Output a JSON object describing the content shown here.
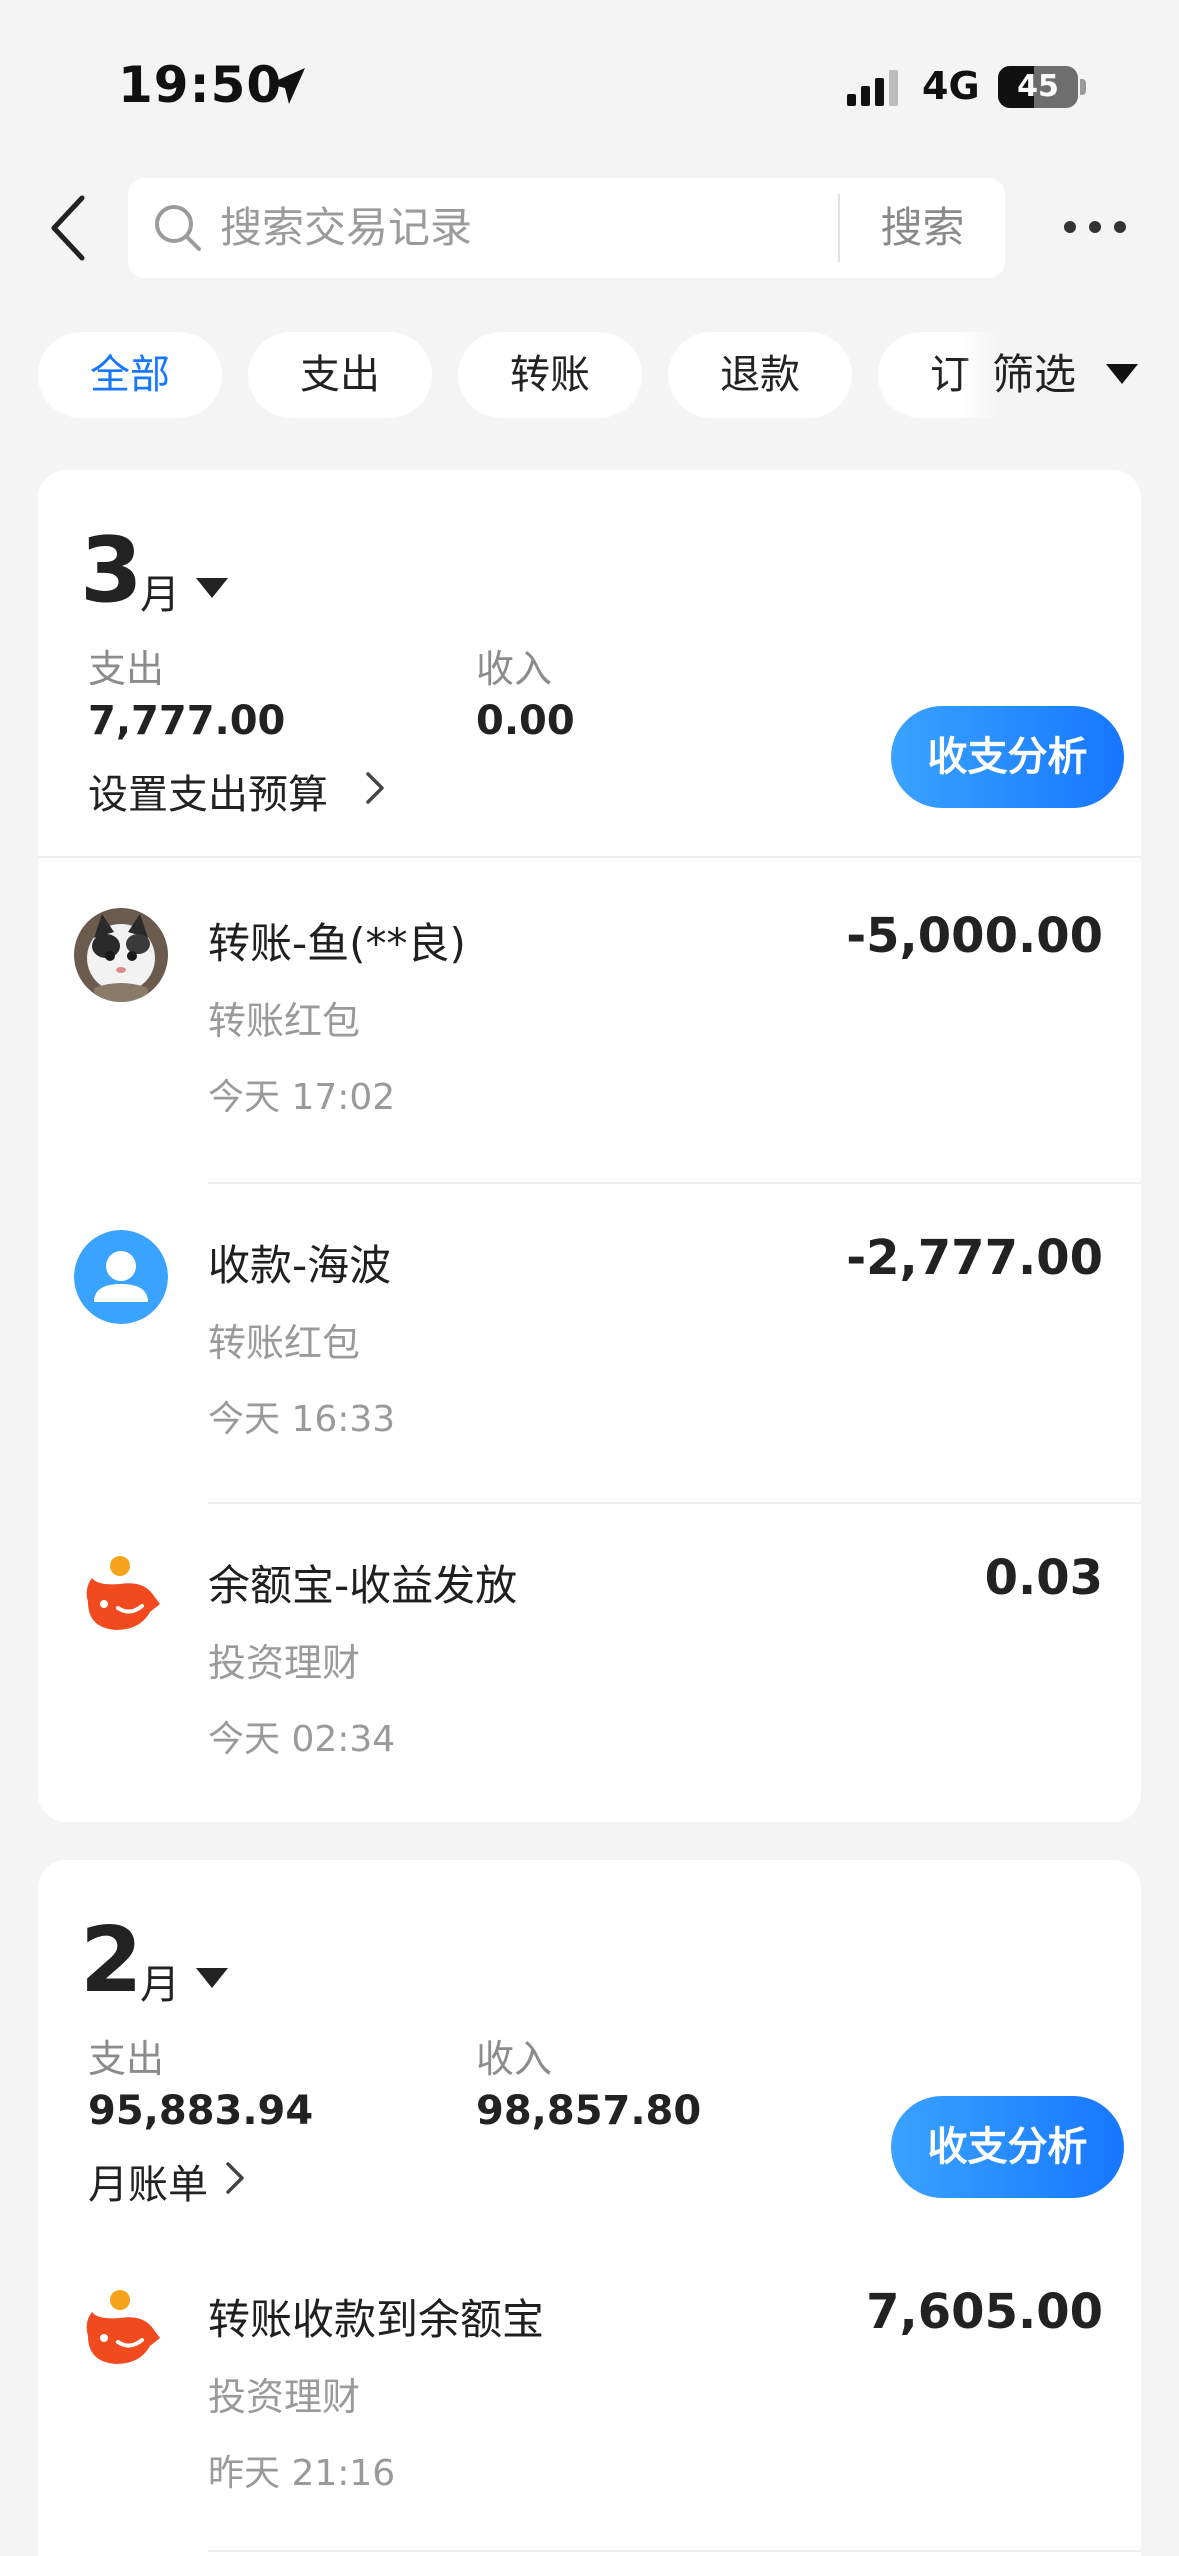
{
  "status_bar": {
    "time": "19:50",
    "network": "4G",
    "battery": "45",
    "battery_level": 0.45
  },
  "search": {
    "placeholder": "搜索交易记录",
    "button_label": "搜索"
  },
  "filters": {
    "chips": [
      "全部",
      "支出",
      "转账",
      "退款",
      "订"
    ],
    "active_index": 0,
    "filter_label": "筛选"
  },
  "months": [
    {
      "number": "3",
      "unit": "月",
      "expense_label": "支出",
      "expense_value": "7,777.00",
      "income_label": "收入",
      "income_value": "0.00",
      "link_label": "设置支出预算",
      "analysis_label": "收支分析",
      "transactions": [
        {
          "title": "转账-鱼(**良)",
          "category": "转账红包",
          "time": "今天 17:02",
          "amount": "-5,000.00",
          "icon": "cat-avatar"
        },
        {
          "title": "收款-海波",
          "category": "转账红包",
          "time": "今天 16:33",
          "amount": "-2,777.00",
          "icon": "default-user-avatar"
        },
        {
          "title": "余额宝-收益发放",
          "category": "投资理财",
          "time": "今天 02:34",
          "amount": "0.03",
          "icon": "yuebao-icon"
        }
      ]
    },
    {
      "number": "2",
      "unit": "月",
      "expense_label": "支出",
      "expense_value": "95,883.94",
      "income_label": "收入",
      "income_value": "98,857.80",
      "link_label": "月账单",
      "analysis_label": "收支分析",
      "transactions": [
        {
          "title": "转账收款到余额宝",
          "category": "投资理财",
          "time": "昨天 21:16",
          "amount": "7,605.00",
          "icon": "yuebao-icon"
        }
      ]
    }
  ],
  "colors": {
    "accent": "#1677ff",
    "background": "#f4f4f4",
    "yuebao_red": "#f04a1e",
    "yuebao_orange": "#f7a21b",
    "avatar_blue": "#3aa2ff"
  }
}
